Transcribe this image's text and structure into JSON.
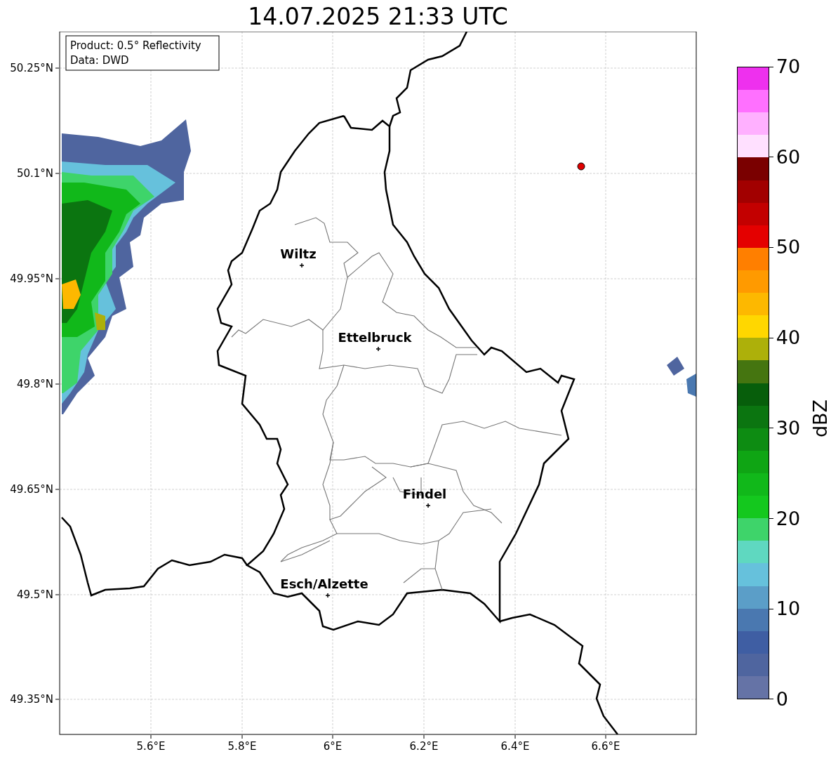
{
  "title": "14.07.2025 21:33 UTC",
  "info_box": {
    "lines": [
      "Product: 0.5° Reflectivity",
      "Data: DWD"
    ]
  },
  "map": {
    "lat_ticks": [
      "50.25°N",
      "50.1°N",
      "49.95°N",
      "49.8°N",
      "49.65°N",
      "49.5°N",
      "49.35°N"
    ],
    "lon_ticks": [
      "5.6°E",
      "5.8°E",
      "6°E",
      "6.2°E",
      "6.4°E",
      "6.6°E"
    ],
    "cities": [
      {
        "name": "Wiltz"
      },
      {
        "name": "Ettelbruck"
      },
      {
        "name": "Findel"
      },
      {
        "name": "Esch/Alzette"
      }
    ]
  },
  "colorbar": {
    "label": "dBZ",
    "ticks": [
      "70",
      "60",
      "50",
      "40",
      "30",
      "20",
      "10",
      "0"
    ],
    "bins": [
      {
        "color": "#ee30ee"
      },
      {
        "color": "#ff70ff"
      },
      {
        "color": "#ffb0ff"
      },
      {
        "color": "#ffe0ff"
      },
      {
        "color": "#7a0000"
      },
      {
        "color": "#a20000"
      },
      {
        "color": "#c30000"
      },
      {
        "color": "#e40000"
      },
      {
        "color": "#ff7f00"
      },
      {
        "color": "#ff9a00"
      },
      {
        "color": "#fdb800"
      },
      {
        "color": "#ffd700"
      },
      {
        "color": "#adb00a"
      },
      {
        "color": "#457510"
      },
      {
        "color": "#075e0b"
      },
      {
        "color": "#0b7510"
      },
      {
        "color": "#0d8c12"
      },
      {
        "color": "#0fa514"
      },
      {
        "color": "#11b81a"
      },
      {
        "color": "#14c81e"
      },
      {
        "color": "#3ed46a"
      },
      {
        "color": "#5fd8c0"
      },
      {
        "color": "#66c1dc"
      },
      {
        "color": "#5b9ec8"
      },
      {
        "color": "#4a78b0"
      },
      {
        "color": "#3f5ea3"
      },
      {
        "color": "#4f659f"
      },
      {
        "color": "#6573a6"
      }
    ]
  }
}
